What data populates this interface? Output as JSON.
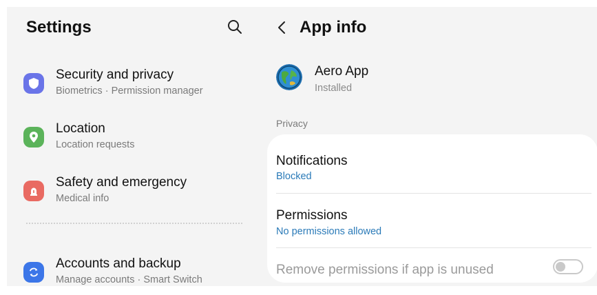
{
  "left": {
    "title": "Settings",
    "items": [
      {
        "title": "Security and privacy",
        "sub": "Biometrics · Permission manager",
        "icon": "shield-icon",
        "color": "#6a74e8"
      },
      {
        "title": "Location",
        "sub": "Location requests",
        "icon": "location-pin-icon",
        "color": "#5bb35a"
      },
      {
        "title": "Safety and emergency",
        "sub": "Medical info",
        "icon": "alert-icon",
        "color": "#e96a62"
      },
      {
        "title": "Accounts and backup",
        "sub": "Manage accounts · Smart Switch",
        "icon": "sync-icon",
        "color": "#3c76e8"
      }
    ]
  },
  "right": {
    "title": "App info",
    "app": {
      "name": "Aero App",
      "status": "Installed",
      "icon": "globe-icon"
    },
    "section_label": "Privacy",
    "rows": {
      "notifications": {
        "title": "Notifications",
        "sub": "Blocked"
      },
      "permissions": {
        "title": "Permissions",
        "sub": "No permissions allowed"
      },
      "remove_unused": {
        "title": "Remove permissions if app is unused",
        "toggle": "off"
      }
    }
  },
  "colors": {
    "background": "#f4f4f4",
    "card": "#ffffff",
    "link_blue": "#2a7ab8",
    "muted": "#7a7a7a",
    "disabled_text": "#9a9a9a"
  }
}
